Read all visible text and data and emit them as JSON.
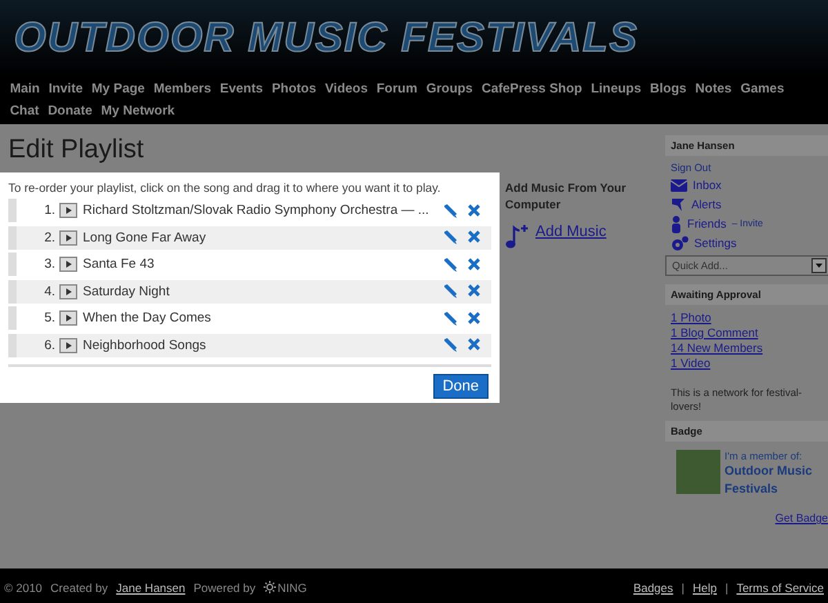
{
  "header": {
    "logo": "OUTDOOR MUSIC FESTIVALS"
  },
  "nav": [
    "Main",
    "Invite",
    "My Page",
    "Members",
    "Events",
    "Photos",
    "Videos",
    "Forum",
    "Groups",
    "CafePress Shop",
    "Lineups",
    "Blogs",
    "Notes",
    "Games",
    "Chat",
    "Donate",
    "My Network"
  ],
  "page_title": "Edit Playlist",
  "playlist_dialog": {
    "instructions": "To re-order your playlist, click on the song and drag it to where you want it to play.",
    "tracks": [
      {
        "number": "1.",
        "title": "Richard Stoltzman/Slovak Radio Symphony Orchestra — ..."
      },
      {
        "number": "2.",
        "title": "Long Gone Far Away"
      },
      {
        "number": "3.",
        "title": "Santa Fe 43"
      },
      {
        "number": "4.",
        "title": "Saturday Night"
      },
      {
        "number": "5.",
        "title": "When the Day Comes"
      },
      {
        "number": "6.",
        "title": "Neighborhood Songs"
      }
    ],
    "done_button": "Done"
  },
  "add_music": {
    "heading": "Add Music From Your Computer",
    "link": "Add Music"
  },
  "sidebar": {
    "user_name": "Jane Hansen",
    "sign_out": "Sign Out",
    "links": [
      {
        "kind": "inbox",
        "label": "Inbox"
      },
      {
        "kind": "alerts",
        "label": "Alerts"
      },
      {
        "kind": "friends",
        "label": "Friends",
        "extra": "– Invite"
      },
      {
        "kind": "settings",
        "label": "Settings"
      }
    ],
    "quick_add": {
      "placeholder": "Quick Add..."
    },
    "awaiting_heading": "Awaiting Approval",
    "awaiting_items": [
      "1 Photo",
      "1 Blog Comment",
      "14 New Members",
      "1 Video"
    ],
    "description": "This is a network for festival-lovers!",
    "badge_heading": "Badge",
    "badge": {
      "caption": "I'm a member of:",
      "network": "Outdoor Music Festivals"
    },
    "get_badge": "Get Badge"
  },
  "footer": {
    "copyright": "© 2010",
    "created_by": "Created by",
    "creator": "Jane Hansen",
    "powered_by": "Powered by",
    "brand": "NING",
    "separator": "|",
    "links": [
      "Badges",
      "Help",
      "Terms of Service"
    ]
  }
}
